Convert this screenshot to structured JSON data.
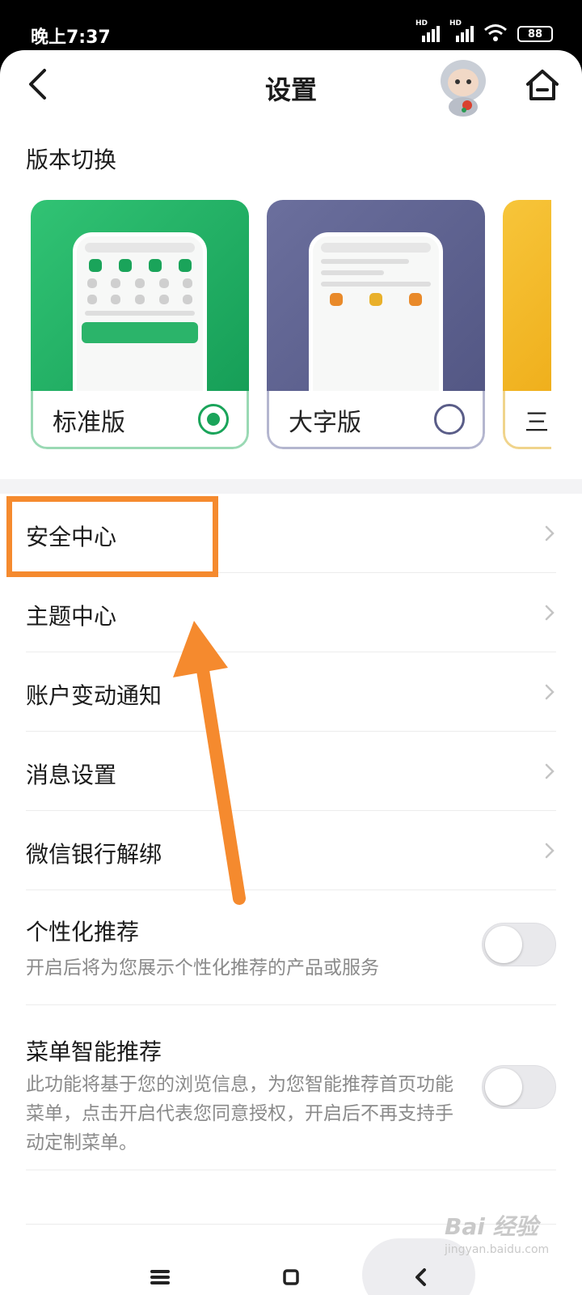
{
  "status_bar": {
    "time": "晚上7:37",
    "network_labels": [
      "HD",
      "HD"
    ],
    "battery": "88"
  },
  "header": {
    "title": "设置",
    "back_icon": "chevron-left-icon",
    "home_icon": "home-icon"
  },
  "version_switch": {
    "title": "版本切换",
    "options": [
      {
        "label": "标准版",
        "selected": true,
        "accent": "#1aa45a"
      },
      {
        "label": "大字版",
        "selected": false,
        "accent": "#5a5d88"
      },
      {
        "label": "三",
        "selected": false,
        "accent": "#eeab16"
      }
    ]
  },
  "menu": {
    "items": [
      {
        "label": "安全中心"
      },
      {
        "label": "主题中心"
      },
      {
        "label": "账户变动通知"
      },
      {
        "label": "消息设置"
      },
      {
        "label": "微信银行解绑"
      }
    ],
    "toggles": [
      {
        "label": "个性化推荐",
        "desc": "开启后将为您展示个性化推荐的产品或服务",
        "on": false
      },
      {
        "label": "菜单智能推荐",
        "desc": "此功能将基于您的浏览信息，为您智能推荐首页功能菜单，点击开启代表您同意授权，开启后不再支持手动定制菜单。",
        "on": false
      }
    ]
  },
  "annotation": {
    "highlight_color": "#f58a2e",
    "target": "安全中心"
  },
  "watermark": {
    "main": "Bai 经验",
    "sub": "jingyan.baidu.com"
  }
}
